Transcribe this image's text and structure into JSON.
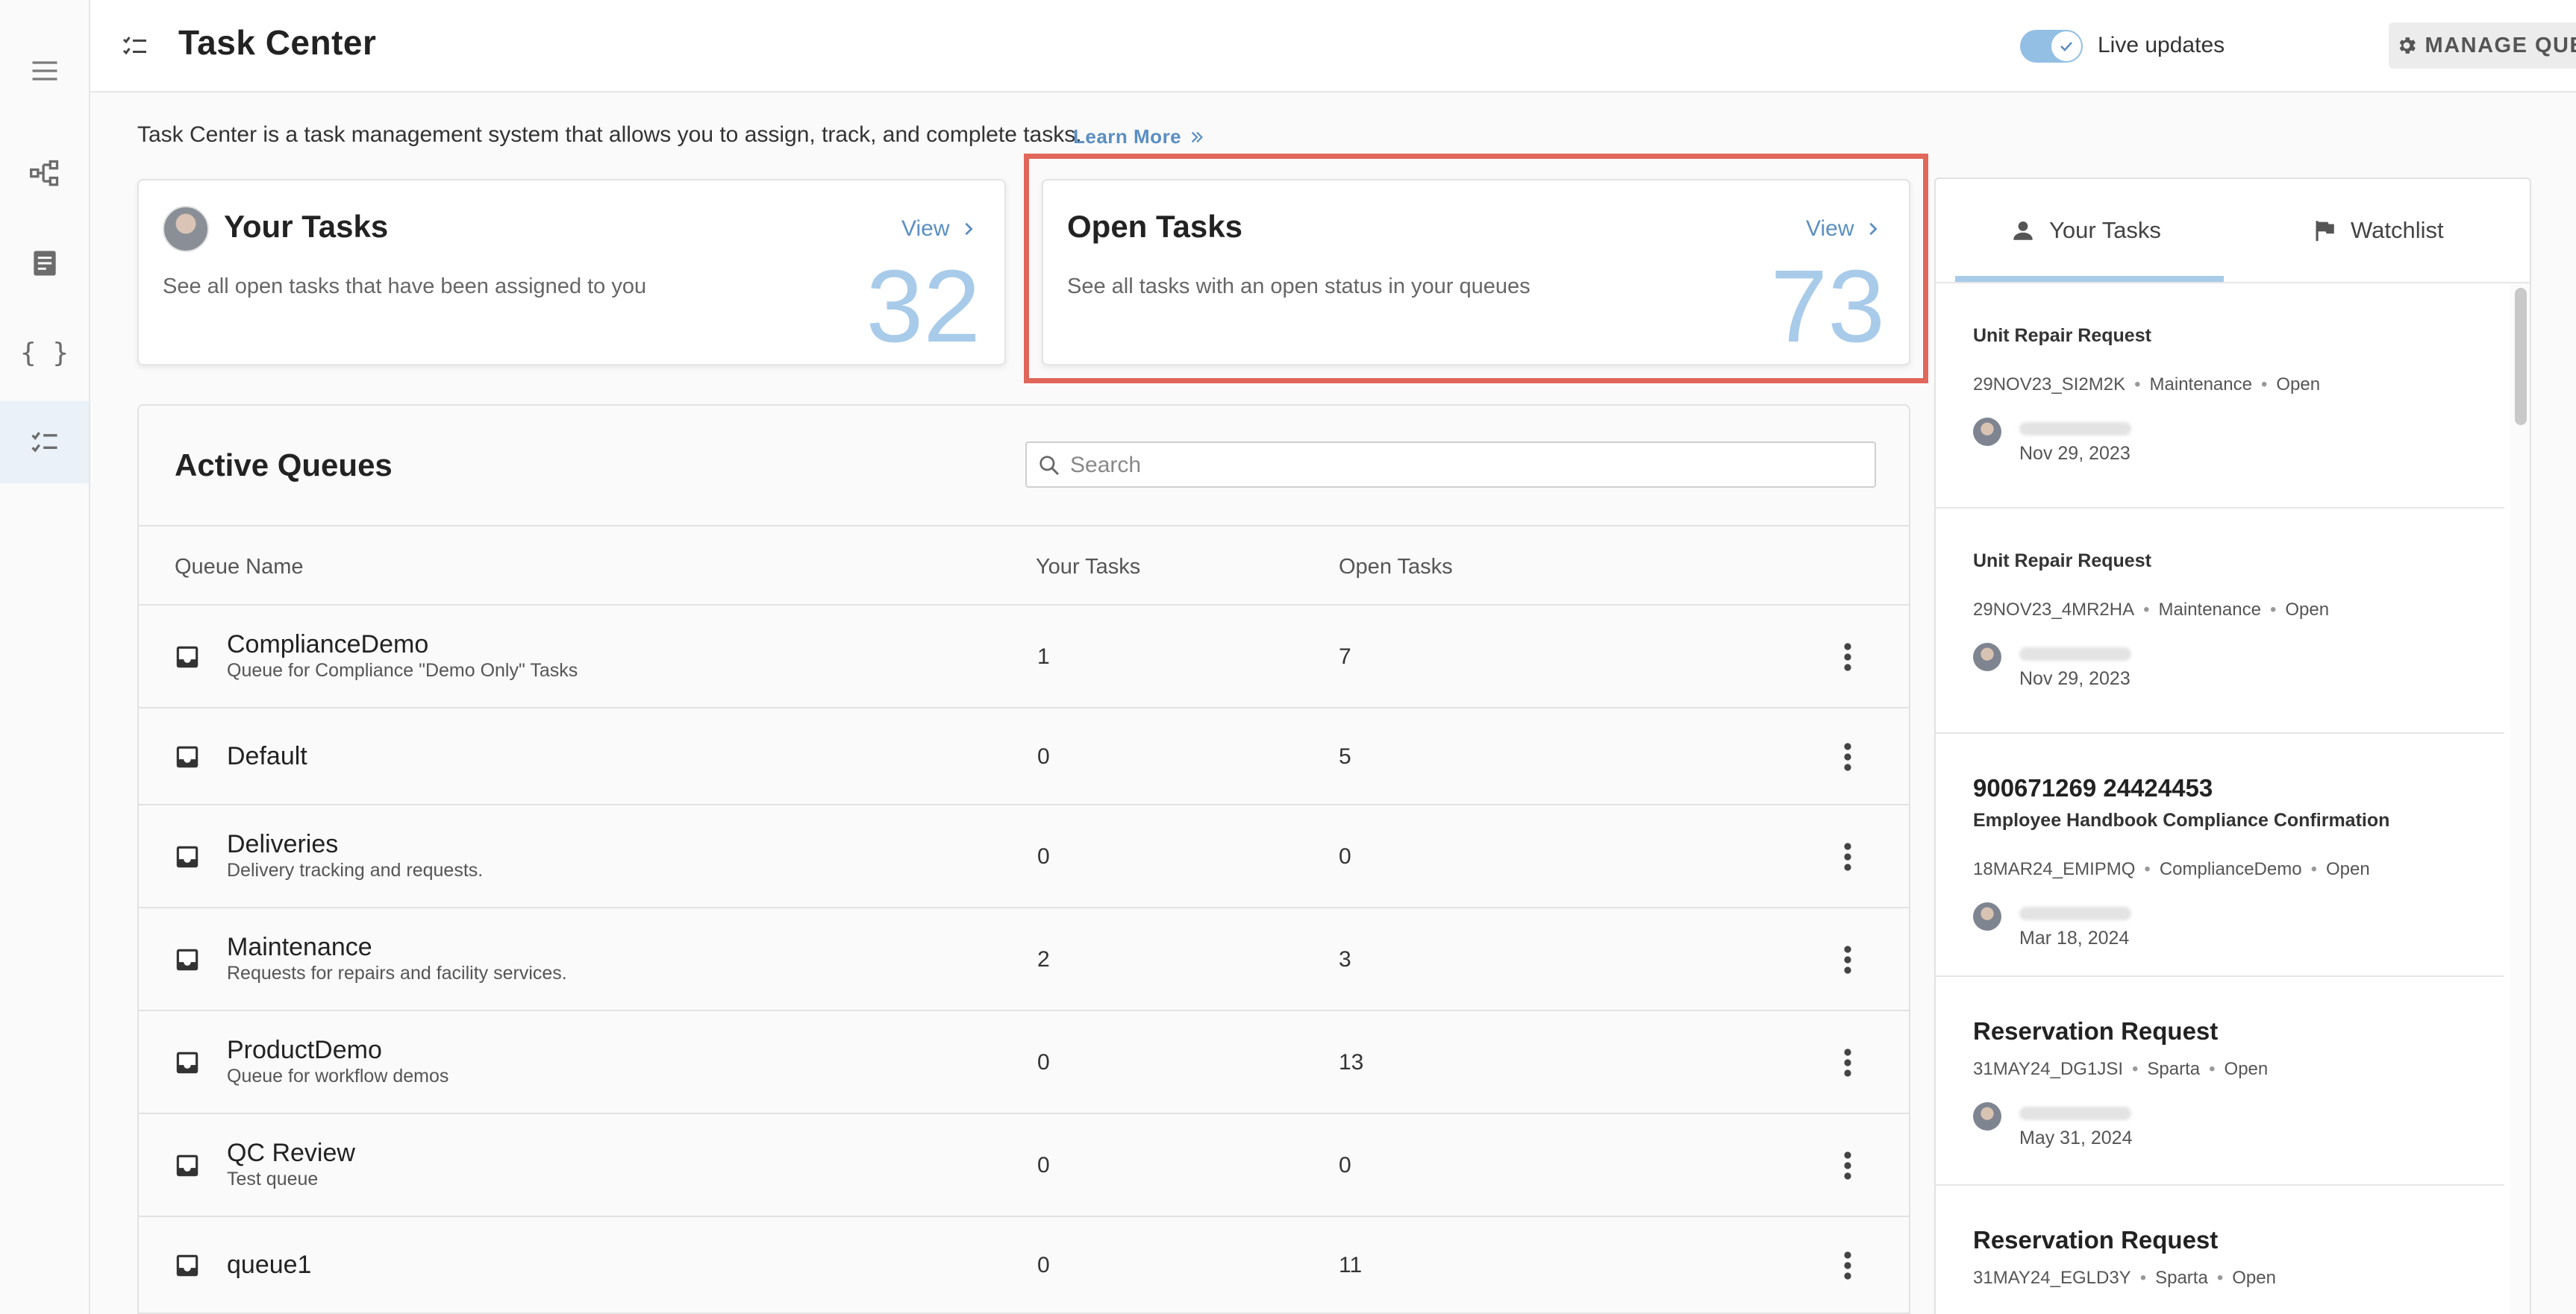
{
  "header": {
    "title": "Task Center",
    "live_updates_label": "Live updates",
    "live_updates_on": true,
    "manage_queues_label": "MANAGE QUEUES"
  },
  "intro": {
    "text": "Task Center is a task management system that allows you to assign, track, and complete tasks.",
    "learn_more": "Learn More"
  },
  "cards": {
    "your_tasks": {
      "title": "Your Tasks",
      "description": "See all open tasks that have been assigned to you",
      "view_label": "View",
      "count": "32"
    },
    "open_tasks": {
      "title": "Open Tasks",
      "description": "See all tasks with an open status in your queues",
      "view_label": "View",
      "count": "73"
    }
  },
  "queues": {
    "title": "Active Queues",
    "search_placeholder": "Search",
    "columns": {
      "name": "Queue Name",
      "your_tasks": "Your Tasks",
      "open_tasks": "Open Tasks"
    },
    "rows": [
      {
        "name": "ComplianceDemo",
        "description": "Queue for Compliance \"Demo Only\" Tasks",
        "your_tasks": "1",
        "open_tasks": "7"
      },
      {
        "name": "Default",
        "description": "",
        "your_tasks": "0",
        "open_tasks": "5"
      },
      {
        "name": "Deliveries",
        "description": "Delivery tracking and requests.",
        "your_tasks": "0",
        "open_tasks": "0"
      },
      {
        "name": "Maintenance",
        "description": "Requests for repairs and facility services.",
        "your_tasks": "2",
        "open_tasks": "3"
      },
      {
        "name": "ProductDemo",
        "description": "Queue for workflow demos",
        "your_tasks": "0",
        "open_tasks": "13"
      },
      {
        "name": "QC Review",
        "description": "Test queue",
        "your_tasks": "0",
        "open_tasks": "0"
      },
      {
        "name": "queue1",
        "description": "",
        "your_tasks": "0",
        "open_tasks": "11"
      }
    ]
  },
  "side_panel": {
    "tabs": {
      "your_tasks": "Your Tasks",
      "watchlist": "Watchlist"
    },
    "tasks": [
      {
        "heading": "",
        "title": "Unit Repair Request",
        "id": "29NOV23_SI2M2K",
        "queue": "Maintenance",
        "status": "Open",
        "date": "Nov 29, 2023"
      },
      {
        "heading": "",
        "title": "Unit Repair Request",
        "id": "29NOV23_4MR2HA",
        "queue": "Maintenance",
        "status": "Open",
        "date": "Nov 29, 2023"
      },
      {
        "heading": "900671269 24424453",
        "title": "Employee Handbook Compliance Confirmation",
        "id": "18MAR24_EMIPMQ",
        "queue": "ComplianceDemo",
        "status": "Open",
        "date": "Mar 18, 2024"
      },
      {
        "heading": "Reservation Request",
        "title": "",
        "id": "31MAY24_DG1JSI",
        "queue": "Sparta",
        "status": "Open",
        "date": "May 31, 2024"
      },
      {
        "heading": "Reservation Request",
        "title": "",
        "id": "31MAY24_EGLD3Y",
        "queue": "Sparta",
        "status": "Open",
        "date": ""
      }
    ]
  }
}
